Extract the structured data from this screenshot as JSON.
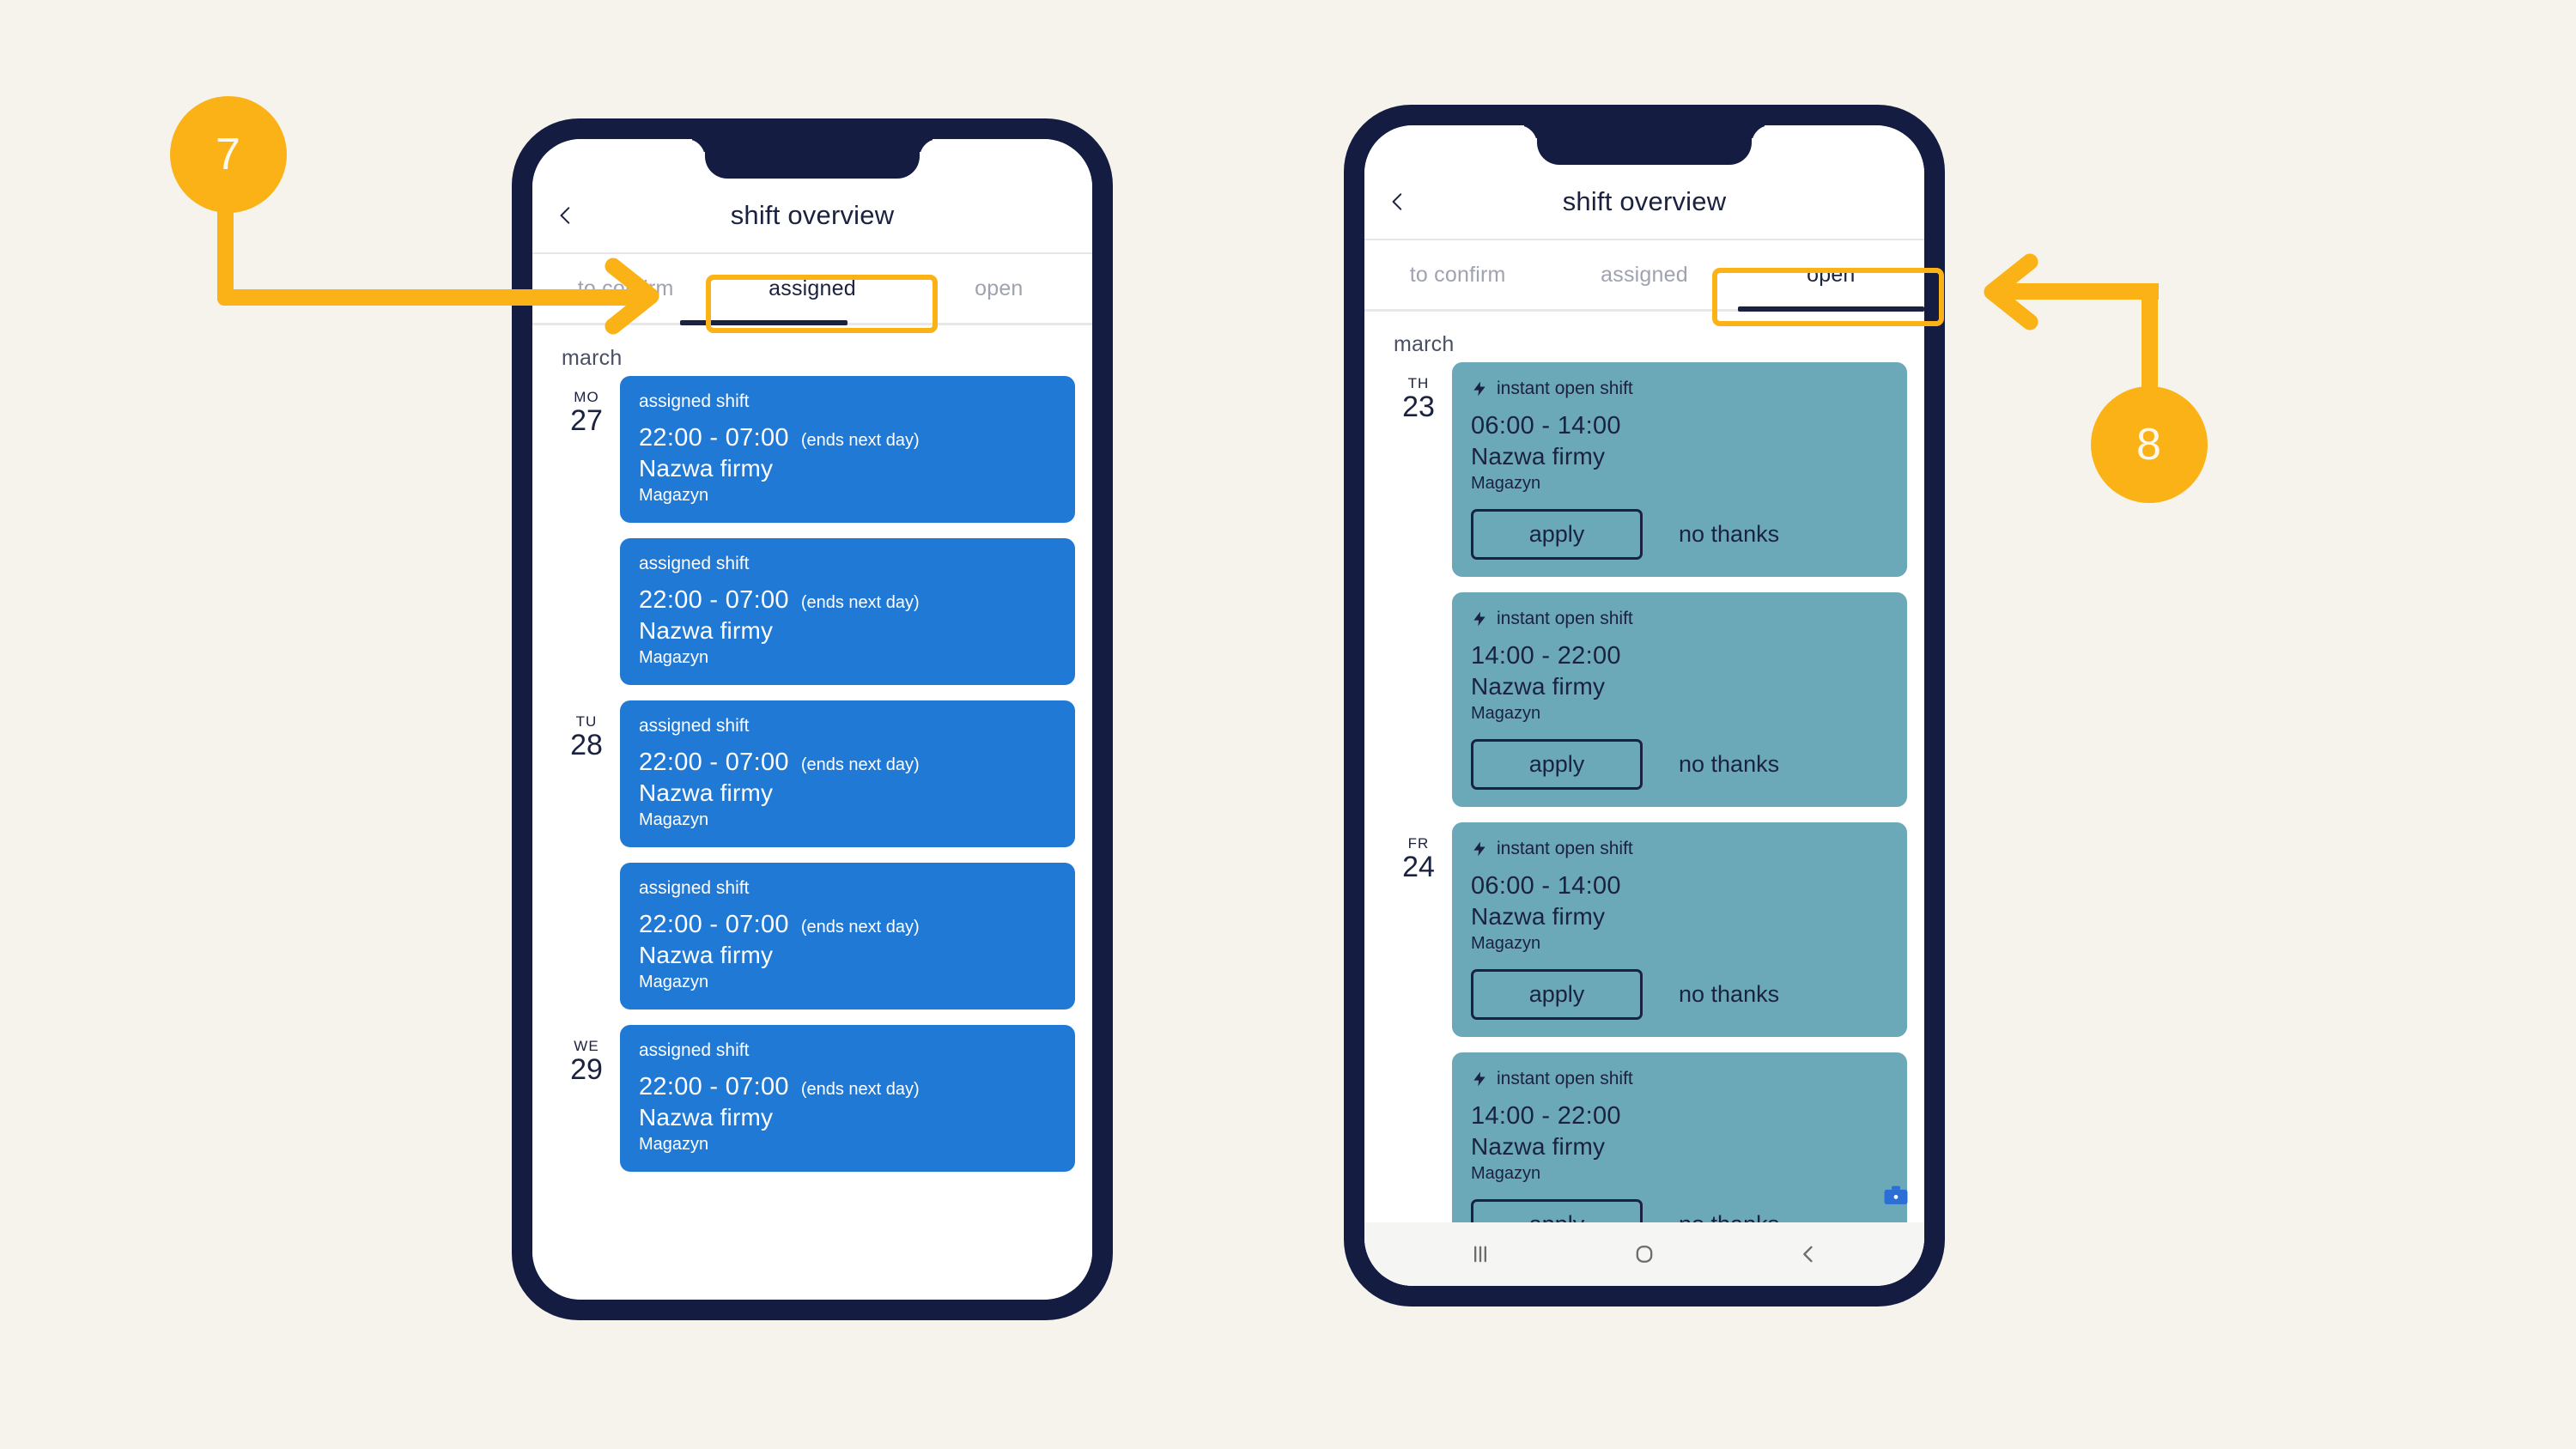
{
  "theme": {
    "page_background": "#f5f3ec",
    "accent": "#fbb217",
    "phone_frame": "#141c41",
    "assigned_card": "#2179d6",
    "open_card": "#6ba8b8",
    "ink": "#1b2240"
  },
  "annotations": [
    {
      "number": "7",
      "points_to": "assigned-tab"
    },
    {
      "number": "8",
      "points_to": "open-tab"
    }
  ],
  "phones": [
    {
      "id": "left",
      "header": {
        "title": "shift overview",
        "back_icon": "chevron-left-icon"
      },
      "tabs": [
        {
          "label": "to confirm",
          "active": false
        },
        {
          "label": "assigned",
          "active": true
        },
        {
          "label": "open",
          "active": false
        }
      ],
      "month": "march",
      "days": [
        {
          "dow": "MO",
          "dom": "27",
          "cards": [
            {
              "kind": "assigned",
              "kicker": "assigned shift",
              "time": "22:00 - 07:00",
              "note": "(ends next day)",
              "company": "Nazwa firmy",
              "department": "Magazyn"
            },
            {
              "kind": "assigned",
              "kicker": "assigned shift",
              "time": "22:00 - 07:00",
              "note": "(ends next day)",
              "company": "Nazwa firmy",
              "department": "Magazyn"
            }
          ]
        },
        {
          "dow": "TU",
          "dom": "28",
          "cards": [
            {
              "kind": "assigned",
              "kicker": "assigned shift",
              "time": "22:00 - 07:00",
              "note": "(ends next day)",
              "company": "Nazwa firmy",
              "department": "Magazyn"
            },
            {
              "kind": "assigned",
              "kicker": "assigned shift",
              "time": "22:00 - 07:00",
              "note": "(ends next day)",
              "company": "Nazwa firmy",
              "department": "Magazyn"
            }
          ]
        },
        {
          "dow": "WE",
          "dom": "29",
          "cards": [
            {
              "kind": "assigned",
              "kicker": "assigned shift",
              "time": "22:00 - 07:00",
              "note": "(ends next day)",
              "company": "Nazwa firmy",
              "department": "Magazyn"
            }
          ]
        }
      ],
      "has_nav_bar": false
    },
    {
      "id": "right",
      "header": {
        "title": "shift overview",
        "back_icon": "chevron-left-icon"
      },
      "tabs": [
        {
          "label": "to confirm",
          "active": false
        },
        {
          "label": "assigned",
          "active": false
        },
        {
          "label": "open",
          "active": true
        }
      ],
      "month": "march",
      "days": [
        {
          "dow": "TH",
          "dom": "23",
          "cards": [
            {
              "kind": "open",
              "kicker": "instant open shift",
              "icon": "bolt-icon",
              "time": "06:00 - 14:00",
              "company": "Nazwa firmy",
              "department": "Magazyn",
              "primary_action": "apply",
              "secondary_action": "no thanks"
            },
            {
              "kind": "open",
              "kicker": "instant open shift",
              "icon": "bolt-icon",
              "time": "14:00 - 22:00",
              "company": "Nazwa firmy",
              "department": "Magazyn",
              "primary_action": "apply",
              "secondary_action": "no thanks"
            }
          ]
        },
        {
          "dow": "FR",
          "dom": "24",
          "cards": [
            {
              "kind": "open",
              "kicker": "instant open shift",
              "icon": "bolt-icon",
              "time": "06:00 - 14:00",
              "company": "Nazwa firmy",
              "department": "Magazyn",
              "primary_action": "apply",
              "secondary_action": "no thanks"
            },
            {
              "kind": "open",
              "kicker": "instant open shift",
              "icon": "bolt-icon",
              "time": "14:00 - 22:00",
              "company": "Nazwa firmy",
              "department": "Magazyn",
              "primary_action": "apply",
              "secondary_action": "no thanks"
            }
          ]
        }
      ],
      "has_nav_bar": true,
      "nav_bar": [
        {
          "icon": "recents-icon"
        },
        {
          "icon": "home-icon"
        },
        {
          "icon": "back-icon"
        }
      ],
      "fab": {
        "icon": "briefcase-icon"
      }
    }
  ]
}
